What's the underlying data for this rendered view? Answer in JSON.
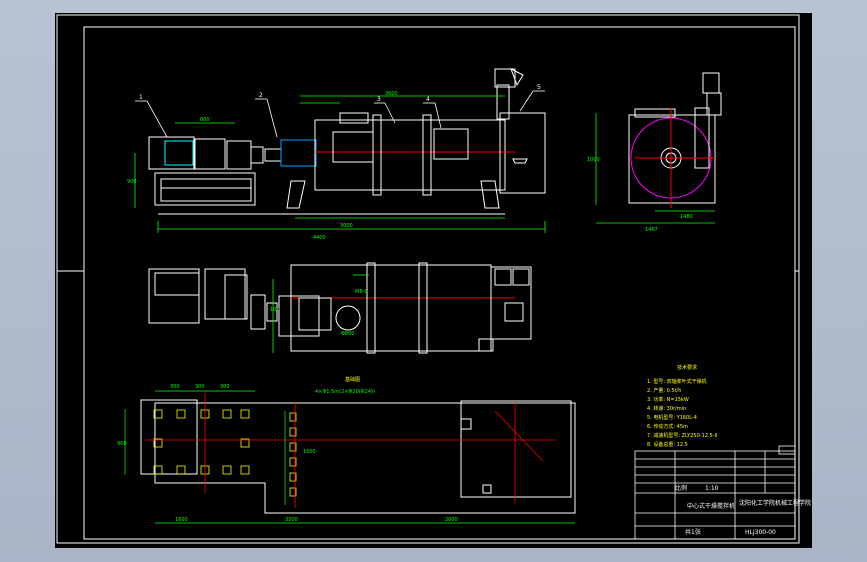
{
  "drawing": {
    "part_labels": [
      "1",
      "2",
      "3",
      "4",
      "5"
    ],
    "foundation_title": "基础图",
    "tech_requirements": {
      "title": "技术要求",
      "lines": [
        "1. 型号: 双轴桨叶式干燥机",
        "2. 产量: 0.5t/h",
        "3. 功率: N=15kW",
        "4. 转速: 30r/min",
        "5. 电机型号: Y160L-4",
        "6. 传动方式: 45m",
        "7. 减速机型号: ZLY250-12.5-II",
        "8. 设备总重: 12.5"
      ]
    },
    "title_block": {
      "drawing_title": "中心式干燥搅拌机",
      "scale_label": "比例",
      "scale_value": "1:10",
      "school": "沈阳化工学院机械工程学院",
      "drawing_number": "HLJ300-00",
      "sheet": "共1张"
    },
    "colors": {
      "background": "#000000",
      "frame": "#ffffff",
      "geometry": "#ffffff",
      "centerline": "#ff0000",
      "dimension": "#00ff00",
      "highlight": "#ffff00",
      "motor": "#00ffff",
      "phantom": "#ff00ff"
    }
  }
}
